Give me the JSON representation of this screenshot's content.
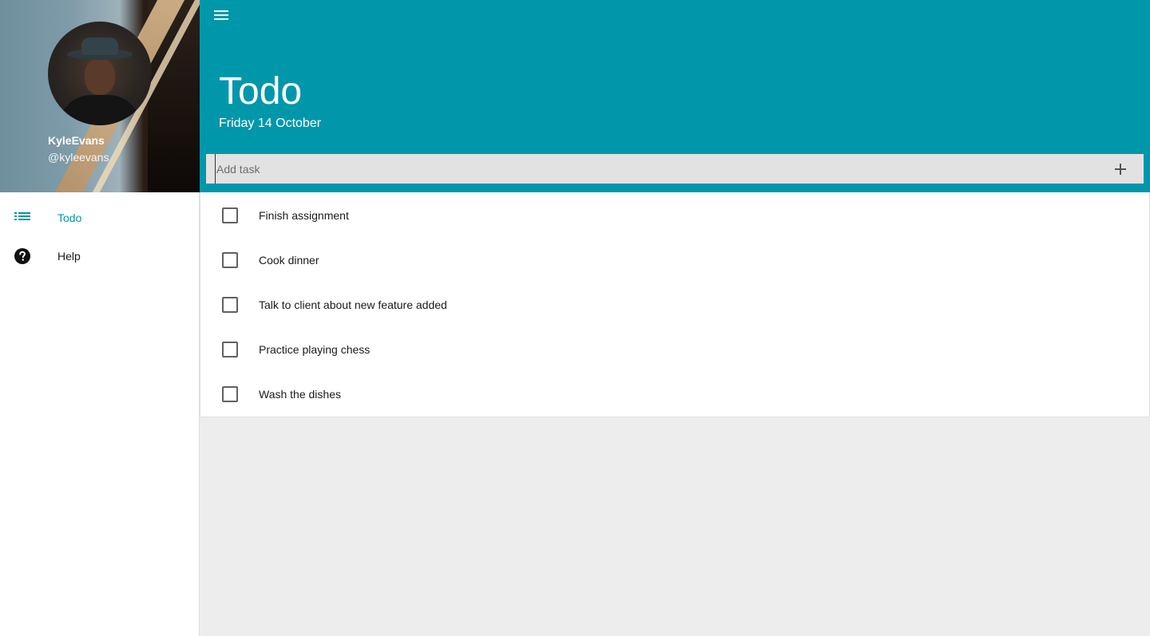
{
  "profile": {
    "name": "KyleEvans",
    "handle": "@kyleevans"
  },
  "nav": {
    "items": [
      {
        "label": "Todo",
        "icon": "list-icon",
        "active": true
      },
      {
        "label": "Help",
        "icon": "help-circle-icon",
        "active": false
      }
    ]
  },
  "header": {
    "menu_icon": "hamburger-menu-icon",
    "title": "Todo",
    "date": "Friday 14 October"
  },
  "add_task": {
    "placeholder": "Add task",
    "value": "",
    "add_icon": "plus-icon"
  },
  "tasks": [
    {
      "text": "Finish assignment",
      "done": false
    },
    {
      "text": "Cook dinner",
      "done": false
    },
    {
      "text": "Talk to client about new feature added",
      "done": false
    },
    {
      "text": "Practice playing chess",
      "done": false
    },
    {
      "text": "Wash the dishes",
      "done": false
    }
  ],
  "colors": {
    "primary": "#0097ab",
    "accent_text": "#0097a7",
    "background": "#ededed"
  }
}
